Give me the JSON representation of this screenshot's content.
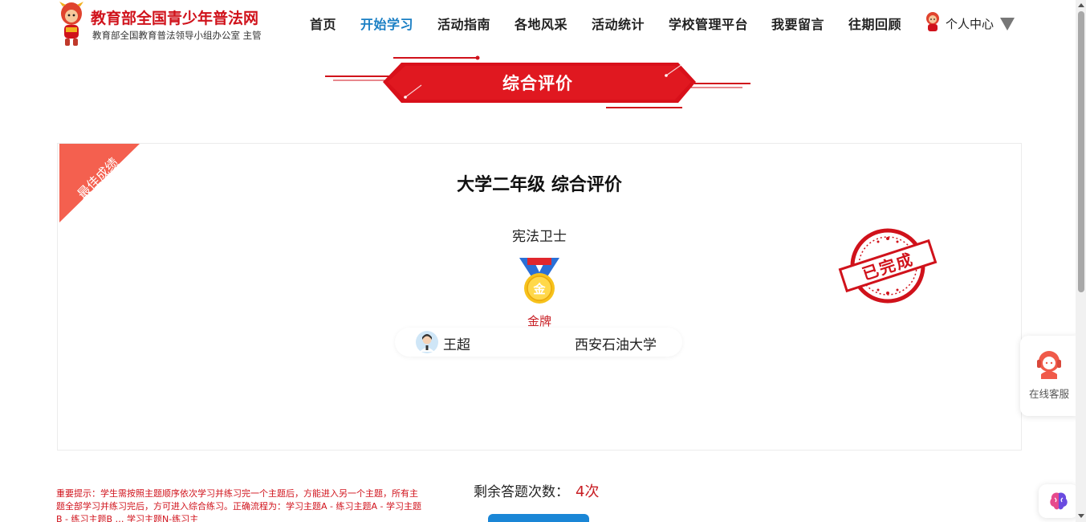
{
  "header": {
    "site_title": "教育部全国青少年普法网",
    "site_subtitle": "教育部全国教育普法领导小组办公室 主管",
    "nav": [
      {
        "label": "首页"
      },
      {
        "label": "开始学习"
      },
      {
        "label": "活动指南"
      },
      {
        "label": "各地风采"
      },
      {
        "label": "活动统计"
      },
      {
        "label": "学校管理平台"
      },
      {
        "label": "我要留言"
      },
      {
        "label": "往期回顾"
      }
    ],
    "active_nav": "开始学习",
    "user_center": "个人中心"
  },
  "banner": {
    "title": "综合评价"
  },
  "result": {
    "ribbon": "最佳成绩",
    "title": "大学二年级 综合评价",
    "honor_title": "宪法卫士",
    "medal_char": "金",
    "medal_label": "金牌",
    "student_name": "王超",
    "school": "西安石油大学",
    "stamp_text": "已完成"
  },
  "side": {
    "service_label": "在线客服"
  },
  "notice": {
    "text": "重要提示：学生需按照主题顺序依次学习并练习完一个主题后，方能进入另一个主题，所有主题全部学习并练习完后，方可进入综合练习。正确流程为：学习主题A - 练习主题A - 学习主题B - 练习主题B … 学习主题N-练习主"
  },
  "attempts": {
    "label": "剩余答题次数：",
    "value": "4次"
  },
  "colors": {
    "brand_red": "#d0121b",
    "active_blue": "#1a7fc4",
    "button_blue": "#1a86d6"
  }
}
